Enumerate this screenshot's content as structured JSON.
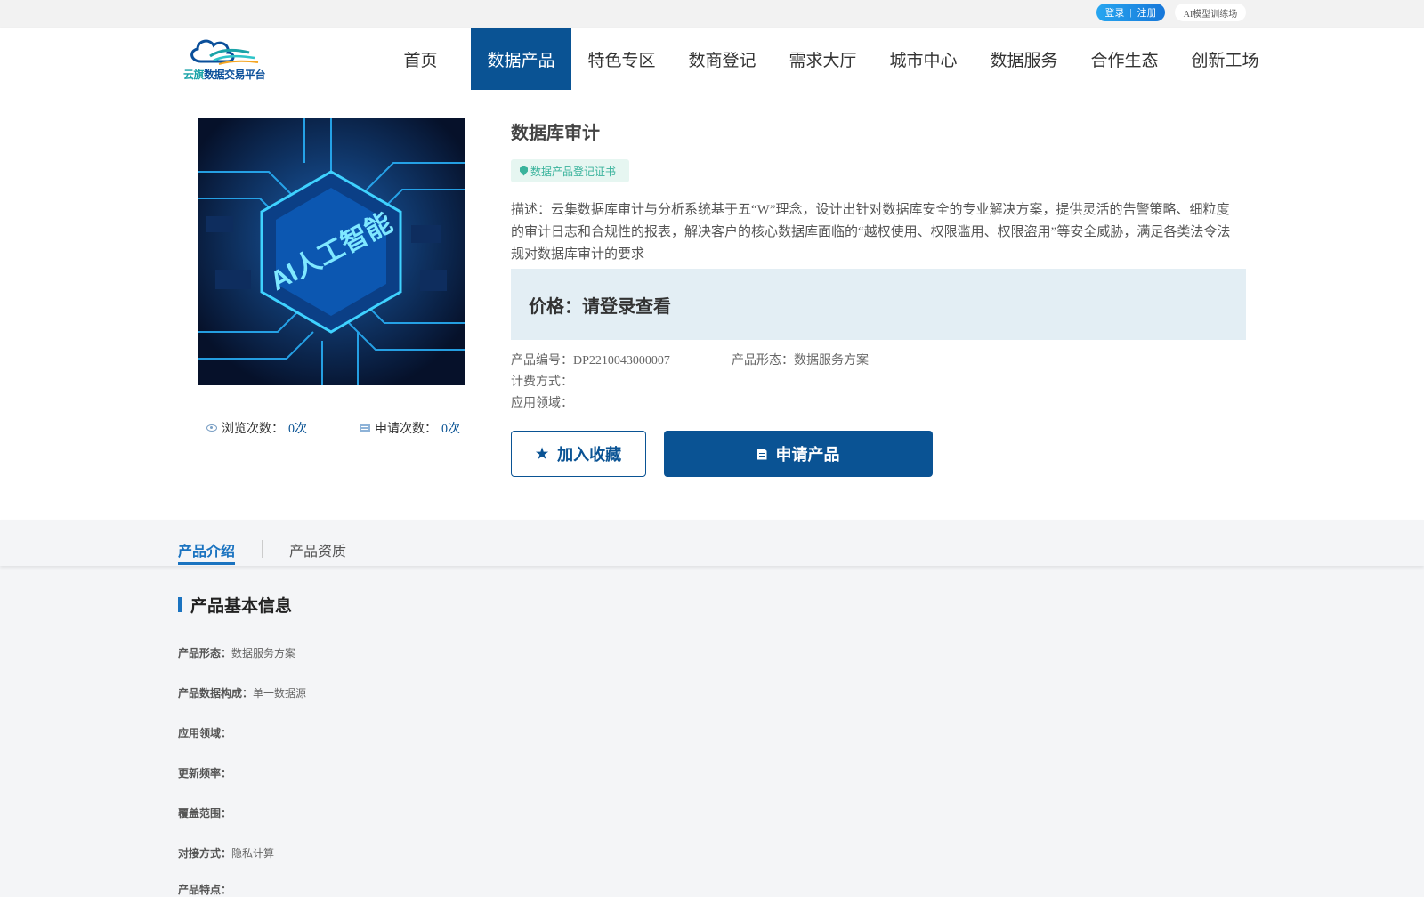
{
  "topbar": {
    "login": "登录",
    "separator": "|",
    "register": "注册",
    "ai_training": "AI模型训练场"
  },
  "header": {
    "logo_primary": "云旗",
    "logo_secondary": "数据交易平台",
    "nav": [
      "首页",
      "数据产品",
      "特色专区",
      "数商登记",
      "需求大厅",
      "城市中心",
      "数据服务",
      "合作生态",
      "创新工场"
    ],
    "active_nav": "数据产品"
  },
  "product": {
    "title": "数据库审计",
    "cert_badge": "数据产品登记证书",
    "description": "描述：云集数据库审计与分析系统基于五“W”理念，设计出针对数据库安全的专业解决方案，提供灵活的告警策略、细粒度的审计日志和合规性的报表，解决客户的核心数据库面临的“越权使用、权限滥用、权限盗用”等安全威胁，满足各类法令法规对数据库审计的要求",
    "price": "价格：请登录查看",
    "code_label": "产品编号：",
    "code_value": "DP2210043000007",
    "form_label": "产品形态：",
    "form_value": "数据服务方案",
    "billing_label": "计费方式：",
    "domain_label": "应用领域：",
    "views_label": "浏览次数：",
    "views_value": "0次",
    "applies_label": "申请次数：",
    "applies_value": "0次",
    "image_text": "AI人工智能",
    "favorite_button": "加入收藏",
    "apply_button": "申请产品"
  },
  "tabs": {
    "intro": "产品介绍",
    "qualification": "产品资质"
  },
  "basic_info": {
    "title": "产品基本信息",
    "rows": [
      {
        "label": "产品形态：",
        "value": "数据服务方案"
      },
      {
        "label": "产品数据构成：",
        "value": "单一数据源"
      },
      {
        "label": "应用领域：",
        "value": ""
      },
      {
        "label": "更新频率：",
        "value": ""
      },
      {
        "label": "覆盖范围：",
        "value": ""
      },
      {
        "label": "对接方式：",
        "value": "隐私计算"
      },
      {
        "label": "产品特点：",
        "value": ""
      }
    ]
  },
  "colors": {
    "primary": "#0a5394",
    "accent": "#1a73c0",
    "cert": "#3ab39c",
    "price_bg": "#e3eef4"
  },
  "icons": [
    "cloud-logo-icon",
    "eye-icon",
    "document-icon",
    "shield-icon",
    "star-icon",
    "file-icon"
  ]
}
